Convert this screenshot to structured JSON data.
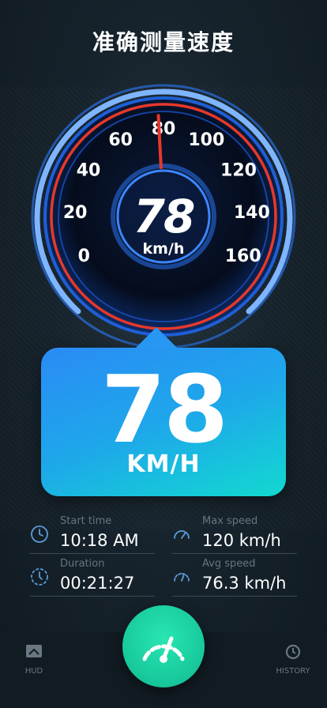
{
  "title": "准确测量速度",
  "gauge": {
    "ticks": [
      "0",
      "20",
      "40",
      "60",
      "80",
      "100",
      "120",
      "140",
      "160"
    ],
    "current_speed": 78,
    "speed_text": "78",
    "unit": "km/h",
    "max": 160
  },
  "big_display": {
    "value": "78",
    "unit": "KM/H"
  },
  "stats": {
    "start_time": {
      "label": "Start time",
      "value": "10:18 AM",
      "icon": "clock-icon"
    },
    "max_speed": {
      "label": "Max speed",
      "value": "120 km/h",
      "icon": "speedometer-icon"
    },
    "duration": {
      "label": "Duration",
      "value": "00:21:27",
      "icon": "timer-icon"
    },
    "avg_speed": {
      "label": "Avg speed",
      "value": "76.3 km/h",
      "icon": "speedometer-icon"
    }
  },
  "nav": {
    "hud": {
      "label": "HUD",
      "icon": "hud-icon"
    },
    "history": {
      "label": "HISTORY",
      "icon": "history-icon"
    },
    "center": {
      "icon": "speedometer-icon"
    }
  },
  "colors": {
    "accent_teal": "#17c79b",
    "card_start": "#2a8bf5",
    "card_end": "#12d9d0",
    "needle": "#e8382b",
    "ring_blue": "#2b7cff"
  }
}
